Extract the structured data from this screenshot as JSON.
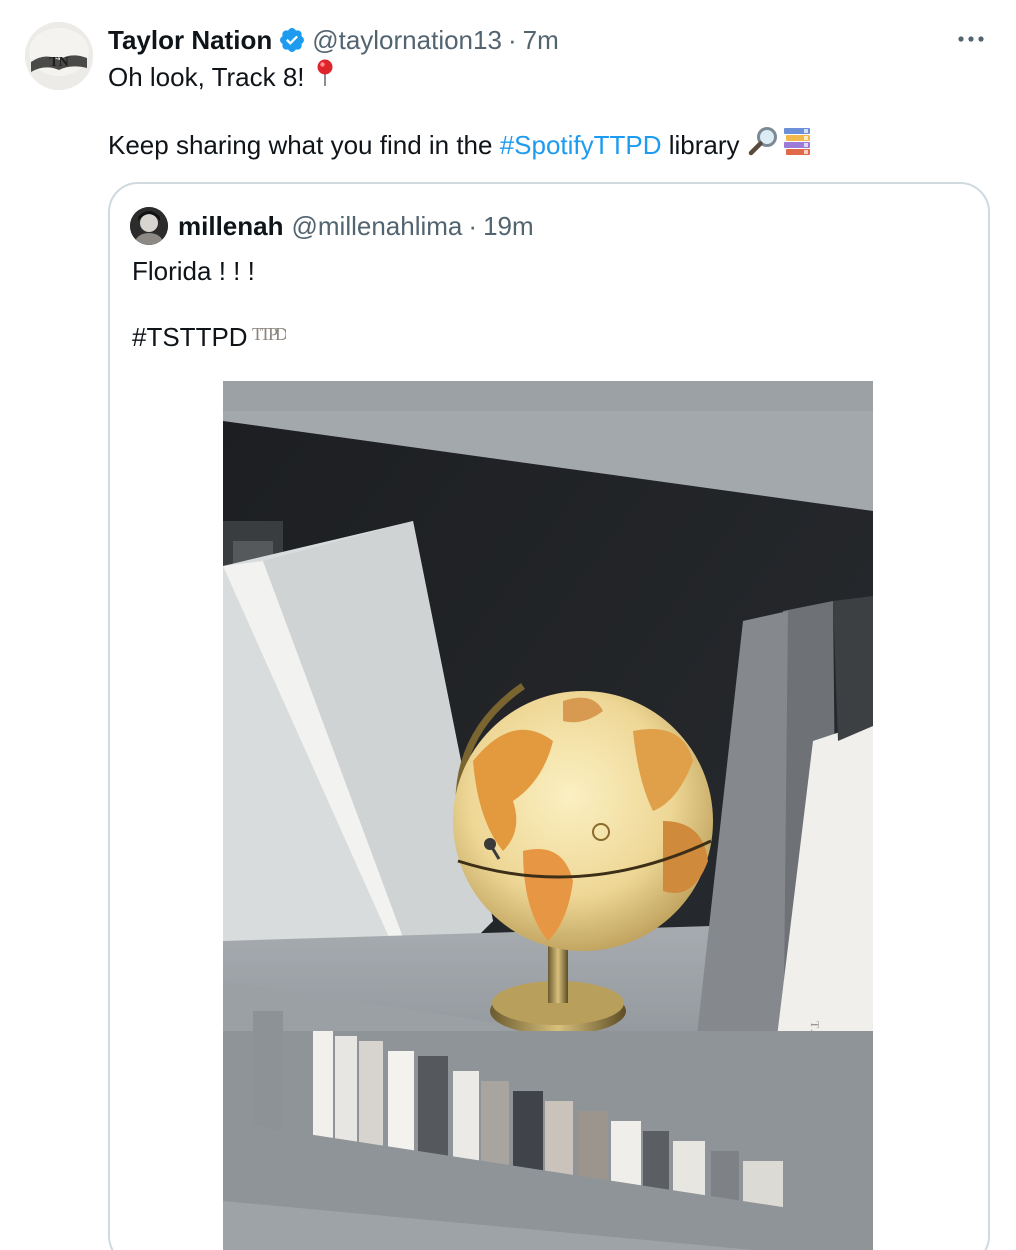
{
  "tweet": {
    "display_name": "Taylor Nation",
    "handle": "@taylornation13",
    "separator": "·",
    "time": "7m",
    "line1_text": "Oh look, Track 8!",
    "line2_before": "Keep sharing what you find in the ",
    "line2_hashtag": "#SpotifyTTPD",
    "line2_after": " library",
    "icons": [
      "verified-badge-icon",
      "pin-icon",
      "magnifier-icon",
      "books-icon",
      "more-icon"
    ],
    "colors": {
      "hashtag": "#1d9bf0",
      "verified": "#1d9bf0",
      "secondary_text": "#536471"
    }
  },
  "quote": {
    "display_name": "millenah",
    "handle": "@millenahlima",
    "separator": "·",
    "time": "19m",
    "line1_text": "Florida ! ! !",
    "line2_text": "#TSTTPD",
    "hashtag_logo": "TTPD"
  }
}
